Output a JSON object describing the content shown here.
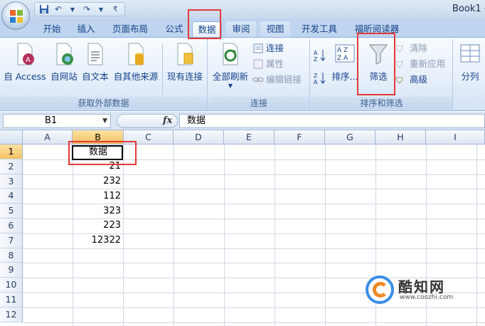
{
  "window": {
    "title": "Book1 -"
  },
  "qat": {
    "save": "save-icon",
    "undo": "↶",
    "redo": "↷",
    "more": "₹"
  },
  "tabs": [
    {
      "label": "开始"
    },
    {
      "label": "插入"
    },
    {
      "label": "页面布局"
    },
    {
      "label": "公式"
    },
    {
      "label": "数据"
    },
    {
      "label": "审阅"
    },
    {
      "label": "视图"
    },
    {
      "label": "开发工具"
    },
    {
      "label": "福昕阅读器"
    }
  ],
  "ribbon": {
    "external": {
      "label": "获取外部数据",
      "from_access": "自 Access",
      "from_web": "自网站",
      "from_text": "自文本",
      "from_other": "自其他来源",
      "existing": "现有连接"
    },
    "connections": {
      "label": "连接",
      "refresh_all": "全部刷新",
      "connections": "连接",
      "properties": "属性",
      "edit_links": "编辑链接"
    },
    "sort_filter": {
      "label": "排序和筛选",
      "sort_az": "A↓Z",
      "sort": "排序...",
      "filter": "筛选",
      "clear": "清除",
      "reapply": "重新应用",
      "advanced": "高级"
    },
    "tools": {
      "split": "分列"
    }
  },
  "formula_bar": {
    "name_box": "B1",
    "fx": "fx",
    "value": "数据"
  },
  "columns": [
    "A",
    "B",
    "C",
    "D",
    "E",
    "F",
    "G",
    "H",
    "I"
  ],
  "rows": [
    "1",
    "2",
    "3",
    "4",
    "5",
    "6",
    "7",
    "8",
    "9",
    "10",
    "11",
    "12"
  ],
  "cells_b": [
    "数据",
    "21",
    "232",
    "112",
    "323",
    "223",
    "12322"
  ],
  "watermark": {
    "name": "酷知网",
    "url": "www.coozhi.com"
  },
  "colors": {
    "accent_red": "#e53935",
    "ribbon_blue": "#15428b"
  }
}
